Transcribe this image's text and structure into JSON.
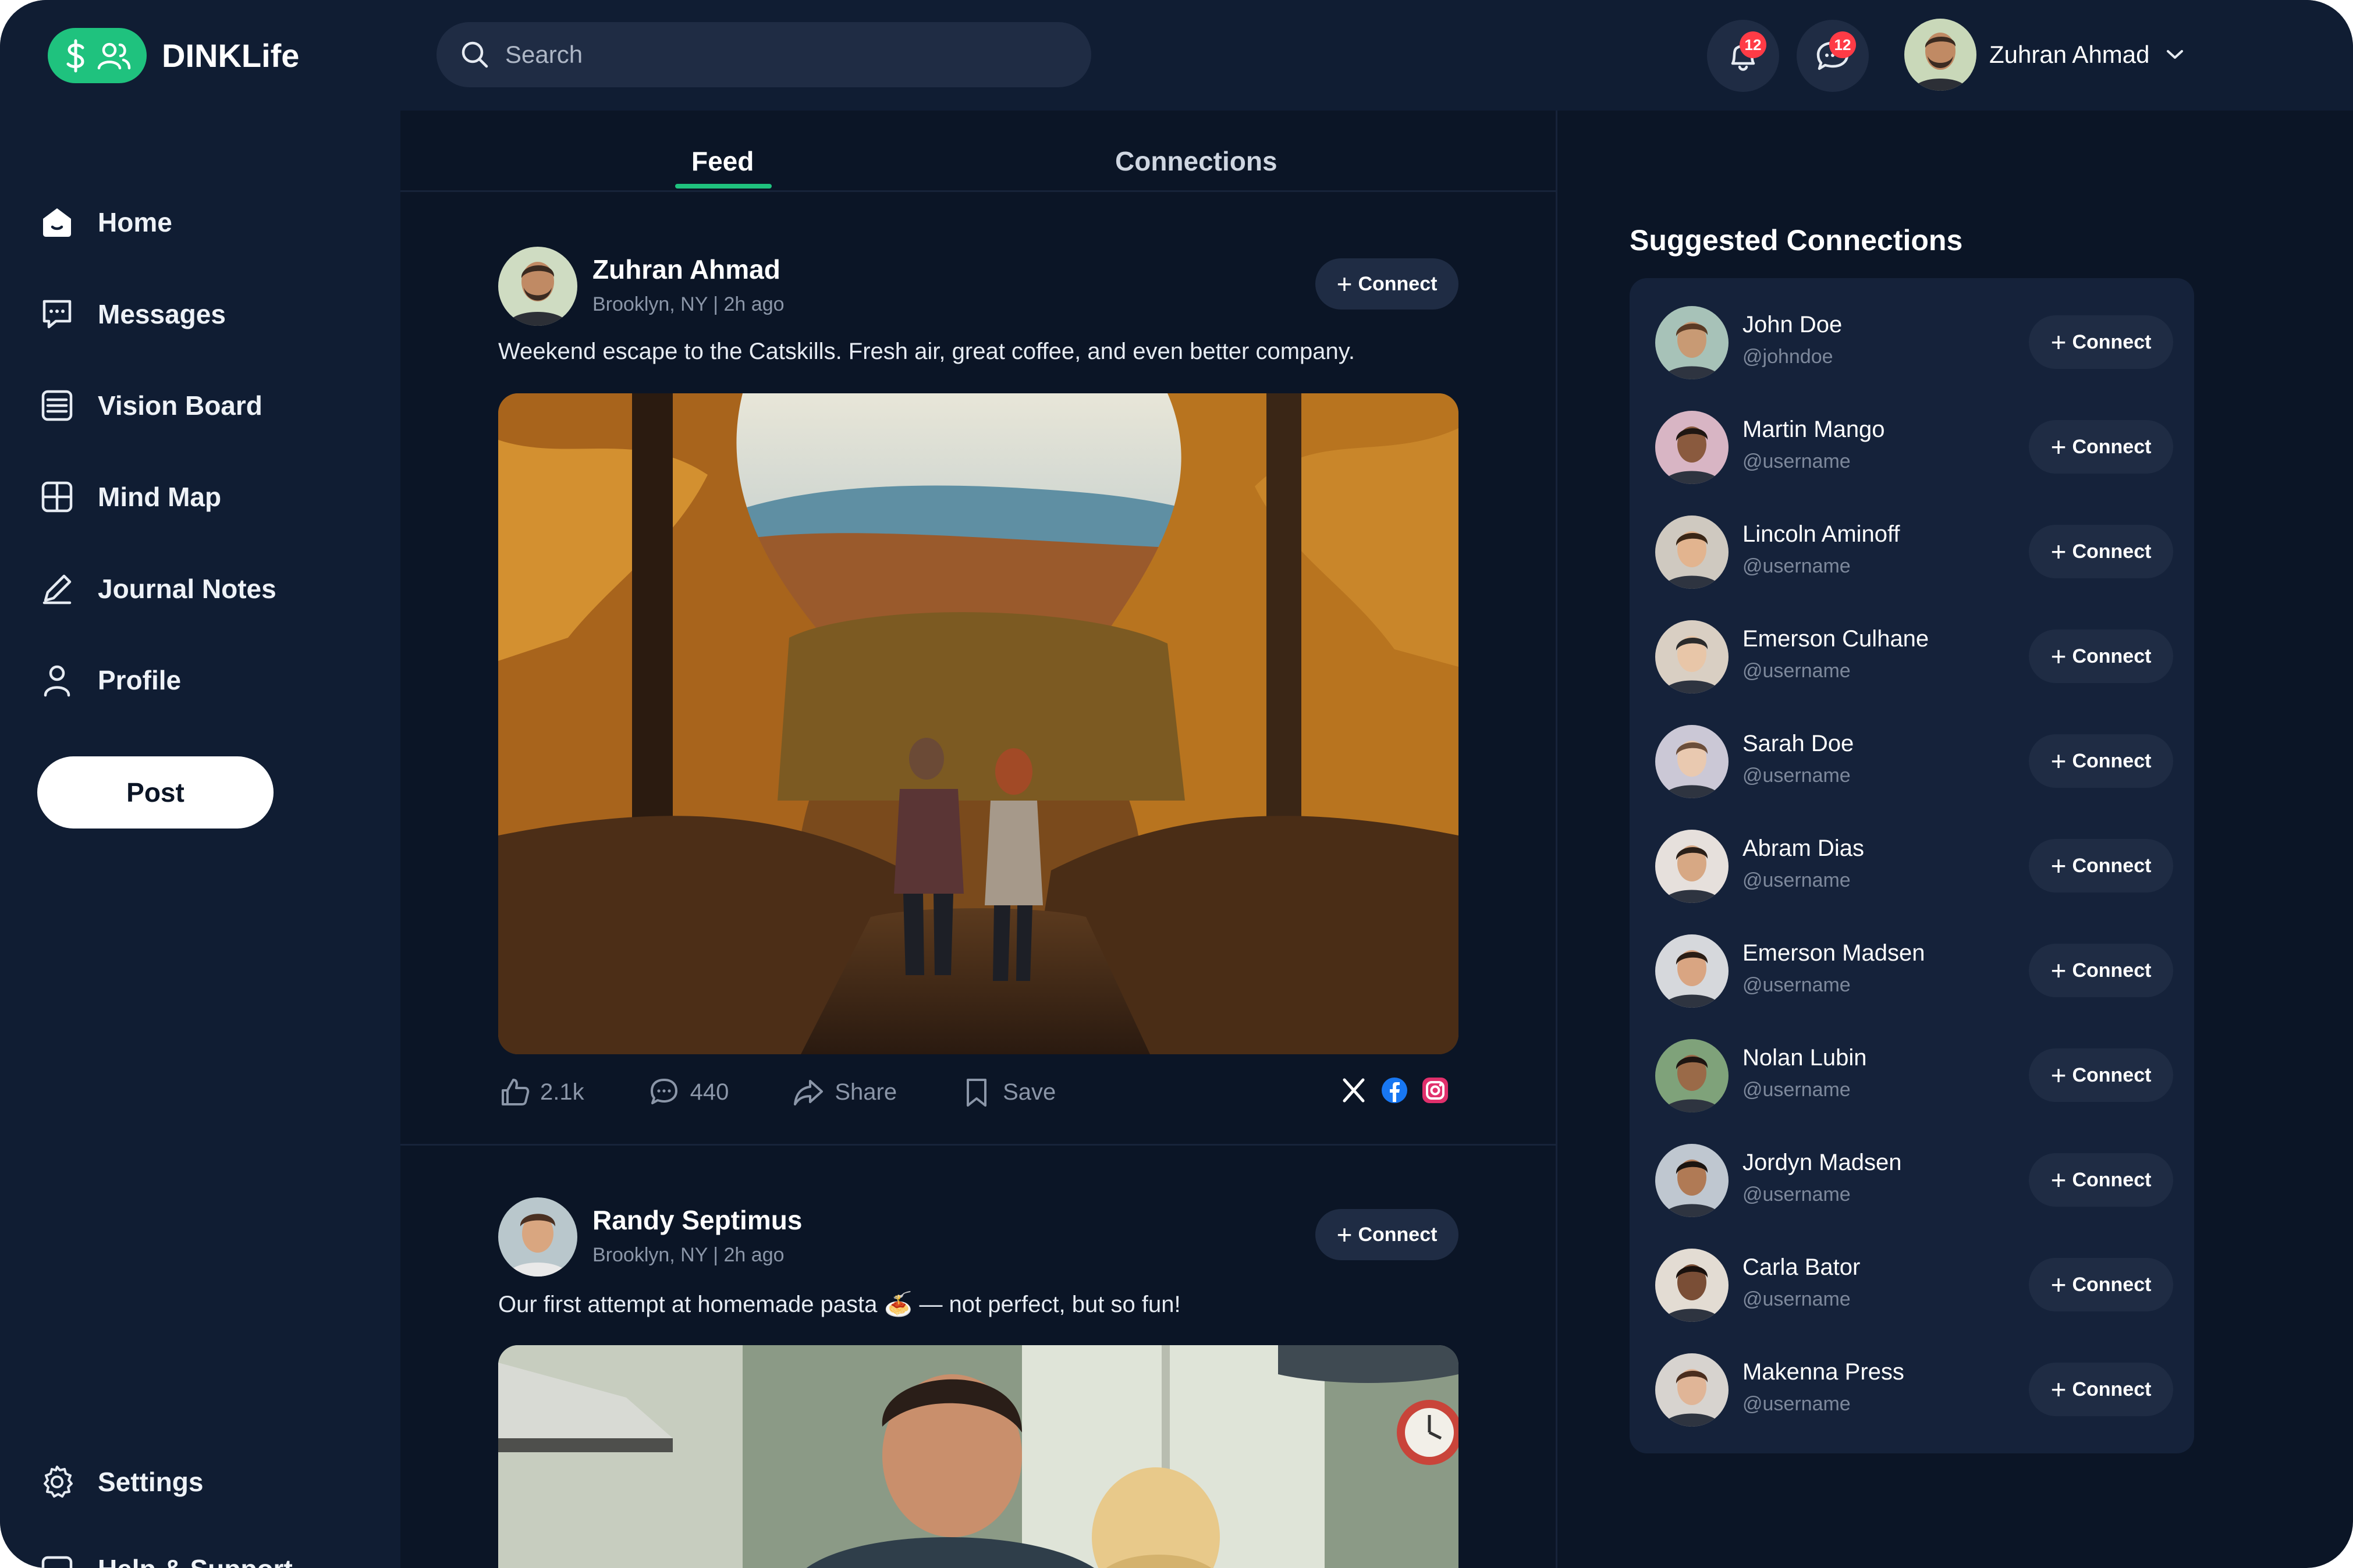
{
  "app": {
    "name": "DINKLife"
  },
  "search": {
    "placeholder": "Search"
  },
  "header": {
    "notifications_count": "12",
    "messages_count": "12",
    "user_name": "Zuhran Ahmad"
  },
  "sidebar": {
    "items": [
      {
        "label": "Home",
        "icon": "home-icon"
      },
      {
        "label": "Messages",
        "icon": "chat-icon"
      },
      {
        "label": "Vision Board",
        "icon": "board-icon"
      },
      {
        "label": "Mind Map",
        "icon": "grid-icon"
      },
      {
        "label": "Journal Notes",
        "icon": "pen-icon"
      },
      {
        "label": "Profile",
        "icon": "user-icon"
      }
    ],
    "post_button": "Post",
    "settings": "Settings",
    "help": "Help & Support"
  },
  "tabs": {
    "feed": "Feed",
    "connections": "Connections"
  },
  "feed": {
    "posts": [
      {
        "author": "Zuhran Ahmad",
        "meta": "Brooklyn, NY | 2h ago",
        "connect": "Connect",
        "text": "Weekend escape to the Catskills. Fresh air, great coffee, and even better company.",
        "likes": "2.1k",
        "comments": "440",
        "share": "Share",
        "save": "Save"
      },
      {
        "author": "Randy Septimus",
        "meta": "Brooklyn, NY | 2h ago",
        "connect": "Connect",
        "text": "Our first attempt at homemade pasta 🍝 — not perfect, but so fun!"
      }
    ]
  },
  "suggestions": {
    "title": "Suggested Connections",
    "connect": "Connect",
    "people": [
      {
        "name": "John Doe",
        "handle": "@johndoe"
      },
      {
        "name": "Martin Mango",
        "handle": "@username"
      },
      {
        "name": "Lincoln Aminoff",
        "handle": "@username"
      },
      {
        "name": "Emerson Culhane",
        "handle": "@username"
      },
      {
        "name": "Sarah Doe",
        "handle": "@username"
      },
      {
        "name": "Abram Dias",
        "handle": "@username"
      },
      {
        "name": "Emerson Madsen",
        "handle": "@username"
      },
      {
        "name": "Nolan Lubin",
        "handle": "@username"
      },
      {
        "name": "Jordyn Madsen",
        "handle": "@username"
      },
      {
        "name": "Carla Bator",
        "handle": "@username"
      },
      {
        "name": "Makenna Press",
        "handle": "@username"
      }
    ]
  },
  "colors": {
    "background": "#0b1526",
    "panel": "#101d33",
    "accent": "#1fc27e",
    "badge": "#ff3b46"
  }
}
